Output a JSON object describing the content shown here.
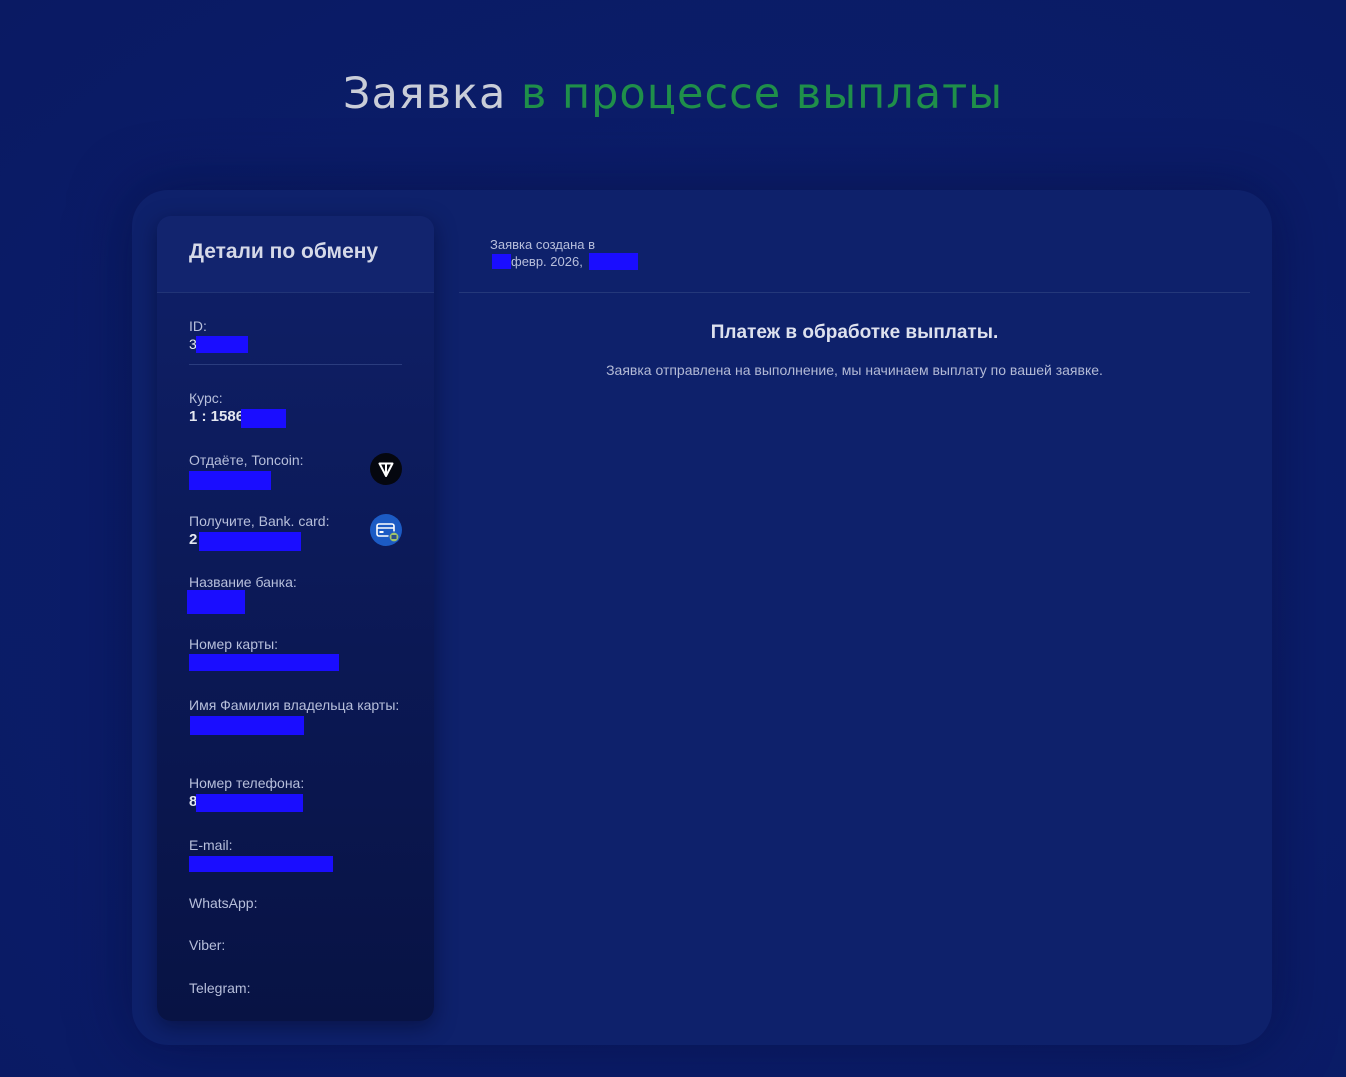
{
  "page": {
    "title_part1": "Заявка",
    "title_part2": "в процессе выплаты"
  },
  "details": {
    "title": "Детали по обмену",
    "id_label": "ID:",
    "id_value": "3",
    "rate_label": "Курс:",
    "rate_value": "1 : 1586",
    "give_label": "Отдаёте, Toncoin:",
    "give_value": "",
    "receive_label": "Получите, Bank. card:",
    "receive_value": "2",
    "bank_name_label": "Название банка:",
    "bank_name_value": "",
    "card_number_label": "Номер карты:",
    "card_number_value": "",
    "holder_label": "Имя Фамилия владельца карты:",
    "holder_value": "",
    "phone_label": "Номер телефона:",
    "phone_value": "8",
    "email_label": "E-mail:",
    "email_value": "",
    "whatsapp_label": "WhatsApp:",
    "viber_label": "Viber:",
    "telegram_label": "Telegram:",
    "give_icon": "toncoin-icon",
    "receive_icon": "bank-card-icon"
  },
  "request": {
    "created_label": "Заявка создана в",
    "created_value": "февр. 2026,",
    "status_title": "Платеж в обработке выплаты.",
    "status_text": "Заявка отправлена на выполнение, мы начинаем выплату по вашей заявке."
  },
  "colors": {
    "background": "#0b1d6a",
    "accent_green": "#1f8f4a",
    "redaction": "#1a0dff"
  }
}
